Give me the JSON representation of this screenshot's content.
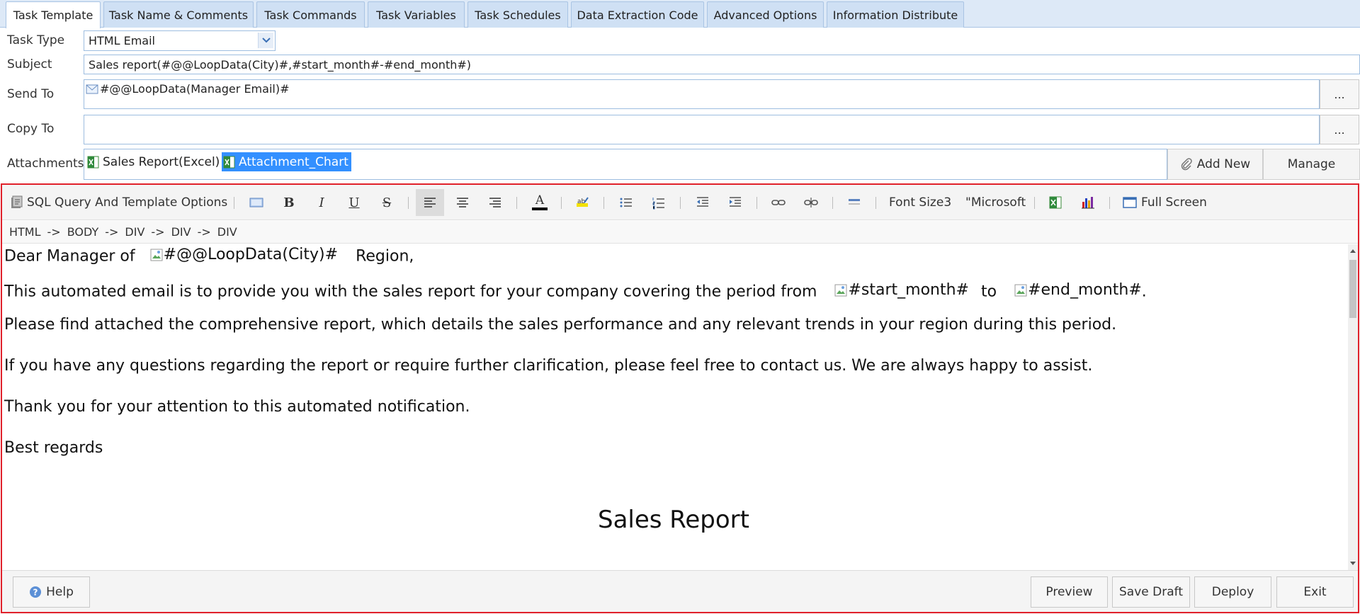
{
  "tabs": [
    {
      "label": "Task Template",
      "active": true
    },
    {
      "label": "Task Name & Comments",
      "active": false
    },
    {
      "label": "Task Commands",
      "active": false
    },
    {
      "label": "Task Variables",
      "active": false
    },
    {
      "label": "Task Schedules",
      "active": false
    },
    {
      "label": "Data Extraction Code",
      "active": false
    },
    {
      "label": "Advanced Options",
      "active": false
    },
    {
      "label": "Information Distribute",
      "active": false
    }
  ],
  "form": {
    "task_type_label": "Task Type",
    "task_type_value": "HTML Email",
    "subject_label": "Subject",
    "subject_value": "Sales report(#@@LoopData(City)#,#start_month#-#end_month#)",
    "send_to_label": "Send To",
    "send_to_value": "#@@LoopData(Manager Email)#",
    "copy_to_label": "Copy To",
    "copy_to_value": "",
    "browse_label": "...",
    "attachments_label": "Attachments",
    "attachments": [
      {
        "name": "Sales Report(Excel)",
        "selected": false
      },
      {
        "name": "Attachment_Chart",
        "selected": true
      }
    ],
    "add_new_label": "Add New",
    "manage_label": "Manage"
  },
  "toolbar": {
    "sql_options_label": "SQL Query And Template Options",
    "font_size_label": "Font Size3",
    "font_name_label": "\"Microsoft",
    "full_screen_label": "Full Screen",
    "icons": [
      "image-icon",
      "bold-icon",
      "italic-icon",
      "underline-icon",
      "strikethrough-icon",
      "align-left-icon",
      "align-center-icon",
      "align-right-icon",
      "font-color-icon",
      "highlight-icon",
      "bullet-list-icon",
      "numbered-list-icon",
      "outdent-icon",
      "indent-icon",
      "link-icon",
      "unlink-icon",
      "horizontal-rule-icon",
      "excel-icon",
      "chart-icon",
      "full-screen-icon"
    ],
    "italic_glyph": "I",
    "bold_glyph": "B",
    "underline_glyph": "U",
    "strike_glyph": "S",
    "font_color_glyph": "A"
  },
  "path": {
    "items": [
      "HTML",
      "BODY",
      "DIV",
      "DIV",
      "DIV"
    ],
    "separator": "->"
  },
  "content": {
    "p1_a": "Dear Manager of",
    "p1_var": "#@@LoopData(City)#",
    "p1_b": "Region,",
    "p2_a": "This automated email is to provide you with the sales report for your company covering the period from",
    "p2_var1": "#start_month#",
    "p2_mid": "to",
    "p2_var2": "#end_month#",
    "p2_end": ".",
    "p3": "Please find attached the comprehensive report, which details the sales performance and any relevant trends in your region during this period.",
    "p4": "If you have any questions regarding the report or require further clarification, please feel free to contact us. We are always happy to assist.",
    "p5": "Thank you for your attention to this automated notification.",
    "p6": "Best regards",
    "report_title": "Sales Report"
  },
  "footer": {
    "help_label": "Help",
    "preview_label": "Preview",
    "save_draft_label": "Save Draft",
    "deploy_label": "Deploy",
    "exit_label": "Exit"
  },
  "colors": {
    "accent": "#3390ff",
    "editor_border": "#e0202a",
    "tab_bg": "#cfe0f4",
    "field_border": "#9dbde0"
  }
}
